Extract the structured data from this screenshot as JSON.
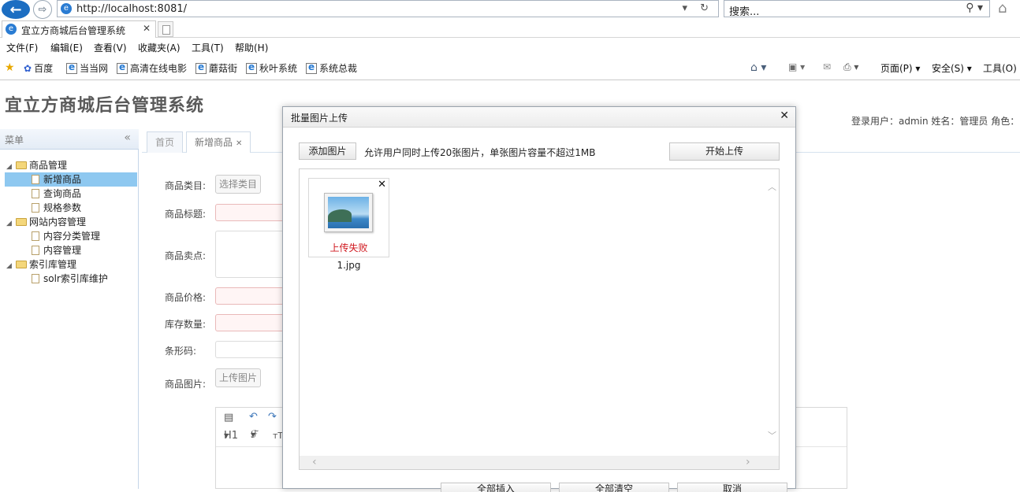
{
  "browser": {
    "url": "http://localhost:8081/",
    "search_placeholder": "搜索...",
    "tab_title": "宜立方商城后台管理系统",
    "menu": [
      "文件(F)",
      "编辑(E)",
      "查看(V)",
      "收藏夹(A)",
      "工具(T)",
      "帮助(H)"
    ],
    "favorites": [
      "百度",
      "当当网",
      "高清在线电影",
      "蘑菇街",
      "秋叶系统",
      "系统总裁"
    ],
    "commands": {
      "page": "页面(P)",
      "safety": "安全(S)",
      "tools": "工具(O)"
    }
  },
  "app": {
    "title": "宜立方商城后台管理系统",
    "user_info": "登录用户：admin  姓名：管理员  角色：",
    "sidebar": {
      "title": "菜单",
      "groups": [
        {
          "label": "商品管理",
          "items": [
            "新增商品",
            "查询商品",
            "规格参数"
          ]
        },
        {
          "label": "网站内容管理",
          "items": [
            "内容分类管理",
            "内容管理"
          ]
        },
        {
          "label": "索引库管理",
          "items": [
            "solr索引库维护"
          ]
        }
      ],
      "selected": "新增商品"
    },
    "tabs": [
      {
        "label": "首页"
      },
      {
        "label": "新增商品"
      }
    ],
    "form": {
      "category_label": "商品类目:",
      "category_button": "选择类目",
      "title_label": "商品标题:",
      "sellpoint_label": "商品卖点:",
      "price_label": "商品价格:",
      "stock_label": "库存数量:",
      "barcode_label": "条形码:",
      "image_label": "商品图片:",
      "image_button": "上传图片"
    },
    "editor": {
      "heading": "H1",
      "font": "ℱ"
    }
  },
  "dialog": {
    "title": "批量图片上传",
    "add_button": "添加图片",
    "hint": "允许用户同时上传20张图片，单张图片容量不超过1MB",
    "start_button": "开始上传",
    "files": [
      {
        "name": "1.jpg",
        "status": "上传失败"
      }
    ],
    "footer_buttons": [
      "全部插入",
      "全部清空",
      "取消"
    ]
  },
  "colors": {
    "accent": "#1c6ec2",
    "selected": "#8ec8f0",
    "error": "#d0181f"
  }
}
